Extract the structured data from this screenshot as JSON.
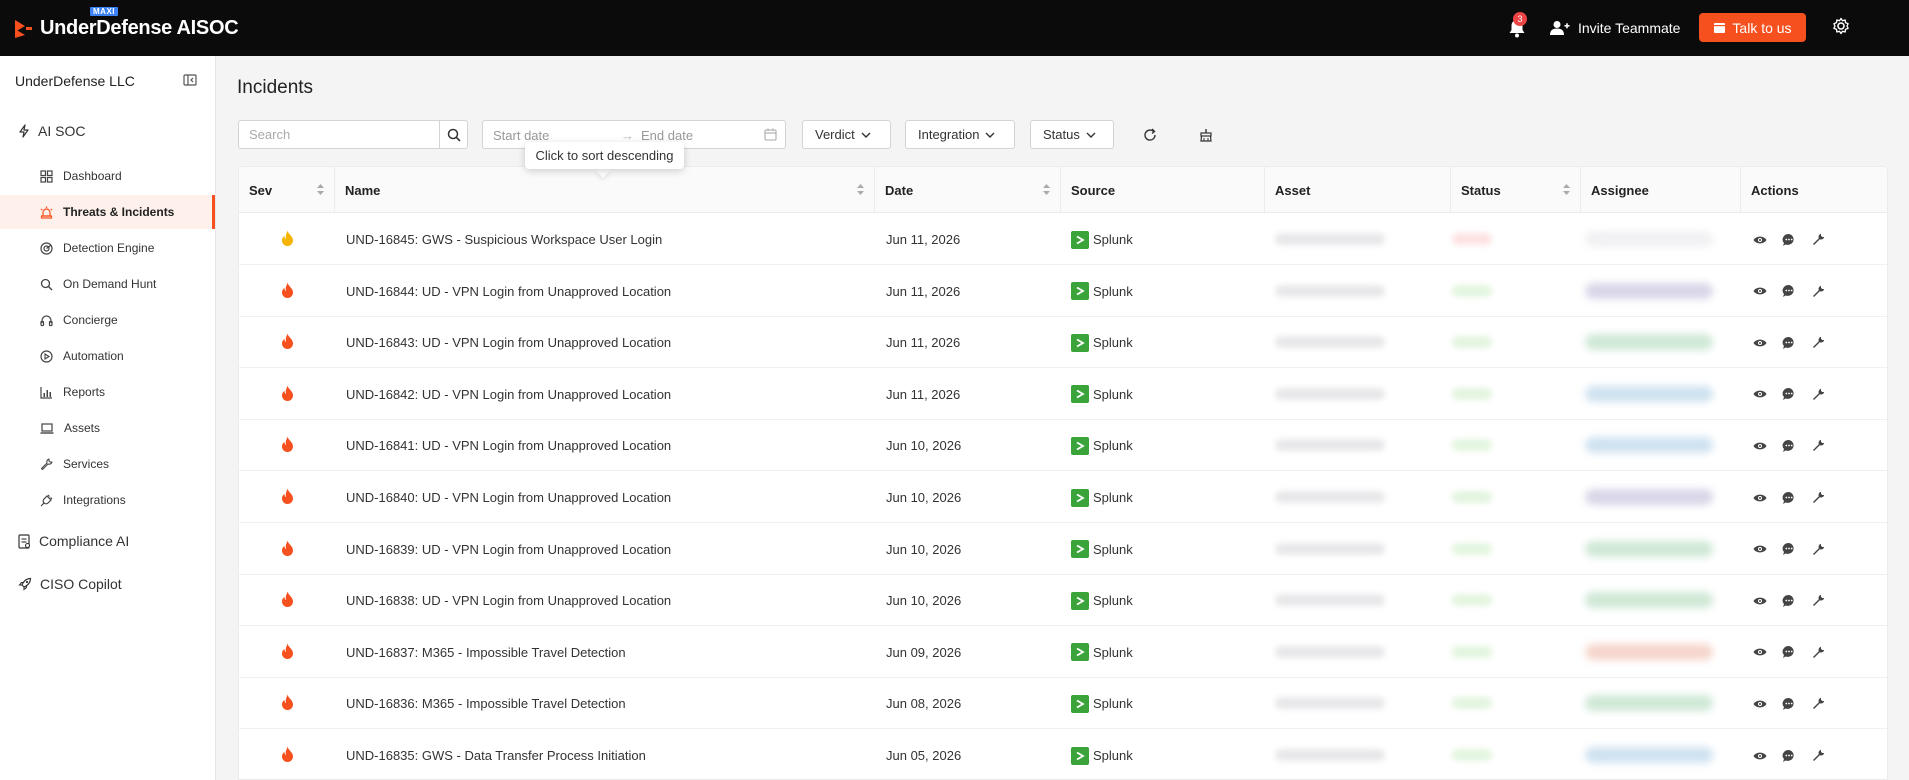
{
  "app": {
    "brand": "UnderDefense AISOC",
    "brand_badge": "MAXI",
    "notifications_count": "3",
    "invite_label": "Invite Teammate",
    "talk_label": "Talk to us",
    "accent_color": "#f5501e"
  },
  "sidebar": {
    "org_name": "UnderDefense LLC",
    "section_aisoc": "AI SOC",
    "items": [
      {
        "label": "Dashboard",
        "icon": "dashboard-icon"
      },
      {
        "label": "Threats & Incidents",
        "icon": "alarm-icon",
        "active": true
      },
      {
        "label": "Detection Engine",
        "icon": "radar-icon"
      },
      {
        "label": "On Demand Hunt",
        "icon": "search-icon"
      },
      {
        "label": "Concierge",
        "icon": "headset-icon"
      },
      {
        "label": "Automation",
        "icon": "play-circle-icon"
      },
      {
        "label": "Reports",
        "icon": "bar-chart-icon"
      },
      {
        "label": "Assets",
        "icon": "laptop-icon"
      },
      {
        "label": "Services",
        "icon": "wrench-icon"
      },
      {
        "label": "Integrations",
        "icon": "plug-icon"
      }
    ],
    "section_compliance": "Compliance AI",
    "section_ciso": "CISO Copilot"
  },
  "main": {
    "title": "Incidents",
    "search_placeholder": "Search",
    "date_start_placeholder": "Start date",
    "date_end_placeholder": "End date",
    "filters": {
      "verdict": "Verdict",
      "integration": "Integration",
      "status": "Status"
    },
    "tooltip": "Click to sort descending"
  },
  "table": {
    "columns": [
      "Sev",
      "Name",
      "Date",
      "Source",
      "Asset",
      "Status",
      "Assignee",
      "Actions"
    ],
    "rows": [
      {
        "sev": "medium",
        "name": "UND-16845: GWS - Suspicious Workspace User Login",
        "date": "Jun 11, 2026",
        "source": "Splunk"
      },
      {
        "sev": "high",
        "name": "UND-16844: UD - VPN Login from Unapproved Location",
        "date": "Jun 11, 2026",
        "source": "Splunk"
      },
      {
        "sev": "high",
        "name": "UND-16843: UD - VPN Login from Unapproved Location",
        "date": "Jun 11, 2026",
        "source": "Splunk"
      },
      {
        "sev": "high",
        "name": "UND-16842: UD - VPN Login from Unapproved Location",
        "date": "Jun 11, 2026",
        "source": "Splunk"
      },
      {
        "sev": "high",
        "name": "UND-16841: UD - VPN Login from Unapproved Location",
        "date": "Jun 10, 2026",
        "source": "Splunk"
      },
      {
        "sev": "high",
        "name": "UND-16840: UD - VPN Login from Unapproved Location",
        "date": "Jun 10, 2026",
        "source": "Splunk"
      },
      {
        "sev": "high",
        "name": "UND-16839: UD - VPN Login from Unapproved Location",
        "date": "Jun 10, 2026",
        "source": "Splunk"
      },
      {
        "sev": "high",
        "name": "UND-16838: UD - VPN Login from Unapproved Location",
        "date": "Jun 10, 2026",
        "source": "Splunk"
      },
      {
        "sev": "high",
        "name": "UND-16837: M365 - Impossible Travel Detection",
        "date": "Jun 09, 2026",
        "source": "Splunk"
      },
      {
        "sev": "high",
        "name": "UND-16836: M365 - Impossible Travel Detection",
        "date": "Jun 08, 2026",
        "source": "Splunk"
      },
      {
        "sev": "high",
        "name": "UND-16835: GWS - Data Transfer Process Initiation",
        "date": "Jun 05, 2026",
        "source": "Splunk"
      }
    ],
    "sev_colors": {
      "medium": "#f5b400",
      "high": "#f5501e"
    },
    "status_colors": [
      "#fde2e2",
      "#e3f5df"
    ],
    "assignee_colors": [
      "#f1f1f3",
      "#d9d6e8",
      "#cfe8d6",
      "#cfe2f0",
      "#cfe2f0",
      "#d9d6e8",
      "#cfe8d6",
      "#cfe8d6",
      "#f6d5cc",
      "#cfe8d6",
      "#cfe2f0"
    ]
  }
}
